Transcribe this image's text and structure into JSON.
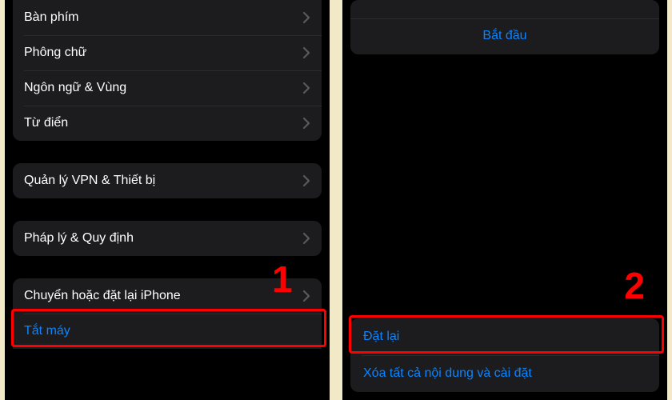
{
  "panel1": {
    "general_items": [
      "Bàn phím",
      "Phông chữ",
      "Ngôn ngữ & Vùng",
      "Từ điển"
    ],
    "vpn_item": "Quản lý VPN & Thiết bị",
    "legal_item": "Pháp lý & Quy định",
    "transfer_item": "Chuyển hoặc đặt lại iPhone",
    "shutdown_item": "Tắt máy",
    "annotation": "1"
  },
  "panel2": {
    "get_started": "Bắt đầu",
    "reset": "Đặt lại",
    "erase_all": "Xóa tất cả nội dung và cài đặt",
    "annotation": "2"
  }
}
